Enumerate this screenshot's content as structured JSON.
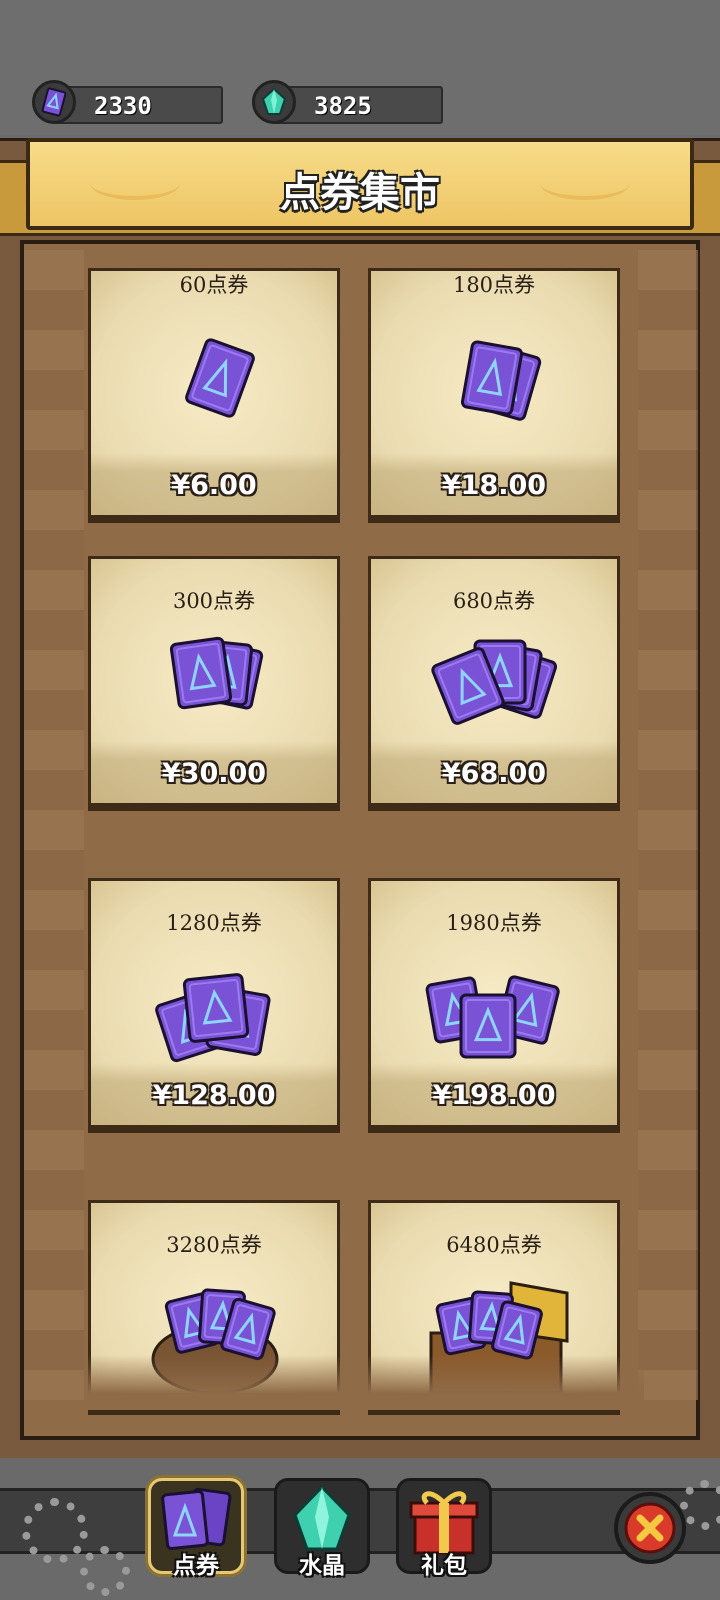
{
  "currencies": [
    {
      "name": "voucher",
      "icon": "voucher-card-icon",
      "value": "2330"
    },
    {
      "name": "crystal",
      "icon": "crystal-icon",
      "value": "3825"
    }
  ],
  "header": {
    "title": "点券集市"
  },
  "products": [
    {
      "label": "60点券",
      "price": "¥6.00",
      "art": "single-card"
    },
    {
      "label": "180点券",
      "price": "¥18.00",
      "art": "two-cards"
    },
    {
      "label": "300点券",
      "price": "¥30.00",
      "art": "card-fan-small"
    },
    {
      "label": "680点券",
      "price": "¥68.00",
      "art": "card-fan-large"
    },
    {
      "label": "1280点券",
      "price": "¥128.00",
      "art": "card-stacks"
    },
    {
      "label": "1980点券",
      "price": "¥198.00",
      "art": "card-piles"
    },
    {
      "label": "3280点券",
      "price": "",
      "art": "card-sack"
    },
    {
      "label": "6480点券",
      "price": "",
      "art": "card-chest"
    }
  ],
  "nav": [
    {
      "label": "点券",
      "icon": "voucher-cards-icon",
      "active": true
    },
    {
      "label": "水晶",
      "icon": "crystal-icon",
      "active": false
    },
    {
      "label": "礼包",
      "icon": "gift-box-icon",
      "active": false
    }
  ],
  "colors": {
    "card_purple": "#7a52d6",
    "accent_gold": "#eec564",
    "close_red": "#d93a2a"
  }
}
